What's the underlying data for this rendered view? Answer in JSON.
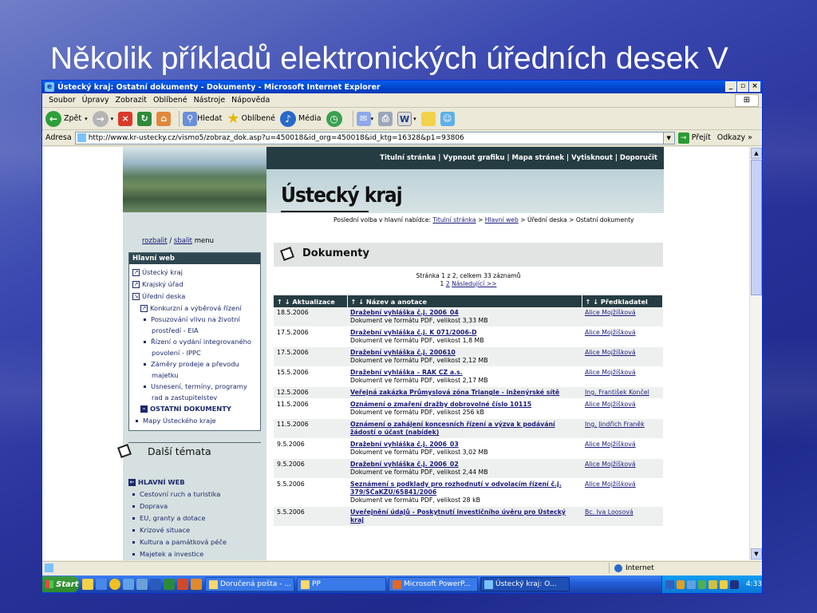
{
  "slide_title": "Několik příkladů elektronických úředních desek V",
  "window": {
    "title": "Ústecký kraj: Ostatní dokumenty - Dokumenty - Microsoft Internet Explorer",
    "menu": [
      "Soubor",
      "Úpravy",
      "Zobrazit",
      "Oblíbené",
      "Nástroje",
      "Nápověda"
    ],
    "toolbar": {
      "back": "Zpět",
      "search": "Hledat",
      "favorites": "Oblíbené",
      "media": "Média"
    },
    "address_label": "Adresa",
    "address_url": "http://www.kr-ustecky.cz/vismo5/zobraz_dok.asp?u=450018&id_org=450018&id_ktg=16328&p1=93806",
    "go_label": "Přejít",
    "links_label": "Odkazy",
    "status_zone": "Internet"
  },
  "site": {
    "top_nav": "Titulní stránka  |  Vypnout grafiku  |  Mapa stránek  |  Vytisknout  |  Doporučit",
    "brand": "Ústecký kraj",
    "breadcrumb_prefix": "Poslední volba v hlavní nabídce:",
    "breadcrumb_1": "Titulní stránka",
    "breadcrumb_2": "Hlavní web",
    "breadcrumb_rest": "> Úřední deska > Ostatní dokumenty",
    "rozbalit": "rozbalit",
    "sbalit": "sbalit",
    "menu_word": "menu",
    "hlavni_web_header": "Hlavní web",
    "nav": [
      {
        "label": "Ústecký kraj"
      },
      {
        "label": "Krajský úřad"
      },
      {
        "label": "Úřední deska"
      },
      {
        "label": "Konkurzní a výběrová řízení"
      },
      {
        "label": "Posuzování vlivu na životní"
      },
      {
        "label": "prostředí - EIA"
      },
      {
        "label": "Řízení o vydání integrovaného"
      },
      {
        "label": "povolení - IPPC"
      },
      {
        "label": "Záměry prodeje a převodu"
      },
      {
        "label": "majetku"
      },
      {
        "label": "Usnesení, termíny, programy"
      },
      {
        "label": "rad a zastupitelstev"
      },
      {
        "label": "OSTATNÍ DOKUMENTY"
      },
      {
        "label": "Mapy Ústeckého kraje"
      }
    ],
    "dalsi_title": "Další témata",
    "dalsi_items": [
      "HLAVNÍ WEB",
      "Cestovní ruch a turistika",
      "Doprava",
      "EU, granty a dotace",
      "Krizové situace",
      "Kultura a památková péče",
      "Majetek a investice"
    ],
    "dokumenty_title": "Dokumenty",
    "page_info": "Stránka 1 z 2, celkem 33 záznamů",
    "page_nums": "1",
    "page_next_num": "2",
    "page_next": "Následující >>",
    "table_headers": [
      "↑ ↓  Aktualizace",
      "↑ ↓  Název a anotace",
      "↑ ↓  Předkladatel"
    ],
    "rows": [
      {
        "date": "18.5.2006",
        "title": "Dražební vyhláška č.j. 2006_04",
        "note": "Dokument ve formátu PDF, velikost 3,33 MB",
        "author": "Alice Mojžíšková"
      },
      {
        "date": "17.5.2006",
        "title": "Dražební vyhláška č.j. K 071/2006-D",
        "note": "Dokument ve formátu PDF, velikost 1,8 MB",
        "author": "Alice Mojžíšková"
      },
      {
        "date": "17.5.2006",
        "title": "Dražební vyhláška č.j. 200610",
        "note": "Dokument ve formátu PDF, velikost 2,12 MB",
        "author": "Alice Mojžíšková"
      },
      {
        "date": "15.5.2006",
        "title": "Dražební vyhláška – RAK CZ a.s.",
        "note": "Dokument ve formátu PDF, velikost 2,17 MB",
        "author": "Alice Mojžíšková"
      },
      {
        "date": "12.5.2006",
        "title": "Veřejná zakázka Průmyslová zóna Triangle - inženýrské sítě",
        "note": "",
        "author": "Ing. František Končel"
      },
      {
        "date": "11.5.2006",
        "title": "Oznámení o zmaření dražby dobrovolné číslo 10115",
        "note": "Dokument ve formátu PDF, velikost 256 kB",
        "author": "Alice Mojžíšková"
      },
      {
        "date": "11.5.2006",
        "title": "Oznámení o zahájení koncesních řízení a výzva k podávání žádostí o účast (nabídek)",
        "note": "",
        "author": "Ing. Jindřich Franěk"
      },
      {
        "date": "9.5.2006",
        "title": "Dražební vyhláška č.j. 2006_03",
        "note": "Dokument ve formátu PDF, velikost 3,02 MB",
        "author": "Alice Mojžíšková"
      },
      {
        "date": "9.5.2006",
        "title": "Dražební vyhláška č.j. 2006_02",
        "note": "Dokument ve formátu PDF, velikost 2,44 MB",
        "author": "Alice Mojžíšková"
      },
      {
        "date": "5.5.2006",
        "title": "Seznámení s podklady pro rozhodnutí v odvolacím řízení č.j. 379/ŠČaKŽÚ/65841/2006",
        "note": "Dokument ve formátu PDF, velikost 28 kB",
        "author": "Alice Mojžíšková"
      },
      {
        "date": "5.5.2006",
        "title": "Uveřejnění údajů - Poskytnutí investičního úvěru pro Ústecký kraj",
        "note": "",
        "author": "Bc. Iva Loosová"
      }
    ]
  },
  "taskbar": {
    "start": "Start",
    "tasks": [
      "Doručená pošta - ...",
      "PP",
      "Microsoft PowerP...",
      "Ústecký kraj: O..."
    ],
    "time": "4:33"
  }
}
